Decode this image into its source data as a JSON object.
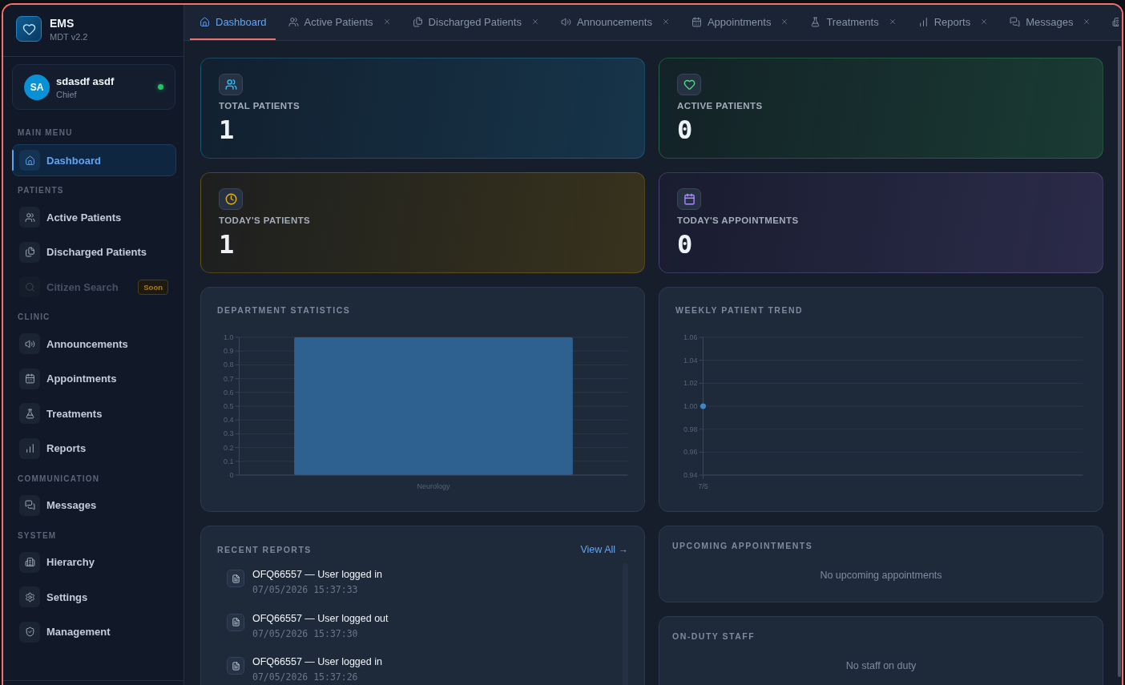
{
  "sidebar": {
    "brand": {
      "title": "EMS",
      "subtitle": "MDT v2.2"
    },
    "user": {
      "initials": "SA",
      "name": "sdasdf asdf",
      "role": "Chief",
      "online": true
    },
    "sections": [
      {
        "title": "MAIN MENU",
        "items": [
          {
            "label": "Dashboard",
            "selected": true,
            "disabled": false
          }
        ]
      },
      {
        "title": "PATIENTS",
        "items": [
          {
            "label": "Active Patients",
            "selected": false,
            "disabled": false
          },
          {
            "label": "Discharged Patients",
            "selected": false,
            "disabled": false
          },
          {
            "label": "Citizen Search",
            "selected": false,
            "disabled": true,
            "badge": "Soon"
          }
        ]
      },
      {
        "title": "CLINIC",
        "items": [
          {
            "label": "Announcements",
            "selected": false,
            "disabled": false
          },
          {
            "label": "Appointments",
            "selected": false,
            "disabled": false
          },
          {
            "label": "Treatments",
            "selected": false,
            "disabled": false
          },
          {
            "label": "Reports",
            "selected": false,
            "disabled": false
          }
        ]
      },
      {
        "title": "COMMUNICATION",
        "items": [
          {
            "label": "Messages",
            "selected": false,
            "disabled": false
          }
        ]
      },
      {
        "title": "SYSTEM",
        "items": [
          {
            "label": "Hierarchy",
            "selected": false,
            "disabled": false
          },
          {
            "label": "Settings",
            "selected": false,
            "disabled": false
          },
          {
            "label": "Management",
            "selected": false,
            "disabled": false
          }
        ]
      }
    ]
  },
  "tabs": [
    {
      "label": "Dashboard",
      "selected": true,
      "closable": false
    },
    {
      "label": "Active Patients",
      "selected": false,
      "closable": true
    },
    {
      "label": "Discharged Patients",
      "selected": false,
      "closable": true
    },
    {
      "label": "Announcements",
      "selected": false,
      "closable": true
    },
    {
      "label": "Appointments",
      "selected": false,
      "closable": true
    },
    {
      "label": "Treatments",
      "selected": false,
      "closable": true
    },
    {
      "label": "Reports",
      "selected": false,
      "closable": true
    },
    {
      "label": "Messages",
      "selected": false,
      "closable": true
    }
  ],
  "stats": [
    {
      "label": "TOTAL PATIENTS",
      "value": "1",
      "color": "#38bdf8"
    },
    {
      "label": "ACTIVE PATIENTS",
      "value": "0",
      "color": "#4ade80"
    },
    {
      "label": "TODAY'S PATIENTS",
      "value": "1",
      "color": "#eab308"
    },
    {
      "label": "TODAY'S APPOINTMENTS",
      "value": "0",
      "color": "#a78bfa"
    }
  ],
  "department_statistics": {
    "chart_data": {
      "type": "bar",
      "title": "DEPARTMENT STATISTICS",
      "categories": [
        "Neurology"
      ],
      "values": [
        1
      ],
      "ylim": [
        0,
        1
      ],
      "grid": true,
      "yticks": [
        {
          "value": 0,
          "label": "0"
        },
        {
          "value": 0.1,
          "label": "0.1"
        },
        {
          "value": 0.2,
          "label": "0.2"
        },
        {
          "value": 0.3,
          "label": "0.3"
        },
        {
          "value": 0.4,
          "label": "0.4"
        },
        {
          "value": 0.5,
          "label": "0.5"
        },
        {
          "value": 0.6,
          "label": "0.6"
        },
        {
          "value": 0.7,
          "label": "0.7"
        },
        {
          "value": 0.8,
          "label": "0.8"
        },
        {
          "value": 0.9,
          "label": "0.9"
        },
        {
          "value": 1,
          "label": "1.0"
        }
      ]
    }
  },
  "weekly_patient_trend": {
    "chart_data": {
      "type": "line",
      "title": "WEEKLY PATIENT TREND",
      "x": [
        "7/5"
      ],
      "series": [
        {
          "color": "#3b88c9",
          "marker": true,
          "values": [
            1
          ]
        }
      ],
      "ylim": [
        0.94,
        1.06
      ],
      "grid": true,
      "yticks": [
        {
          "value": 0.94,
          "label": "0.94"
        },
        {
          "value": 0.96,
          "label": "0.96"
        },
        {
          "value": 0.98,
          "label": "0.98"
        },
        {
          "value": 1,
          "label": "1.00"
        },
        {
          "value": 1.02,
          "label": "1.02"
        },
        {
          "value": 1.04,
          "label": "1.04"
        },
        {
          "value": 1.06,
          "label": "1.06"
        }
      ]
    }
  },
  "recent_reports": {
    "title": "RECENT REPORTS",
    "link": "View All →",
    "items": [
      {
        "title": "OFQ66557 — User logged in",
        "time": "07/05/2026 15:37:33"
      },
      {
        "title": "OFQ66557 — User logged out",
        "time": "07/05/2026 15:37:30"
      },
      {
        "title": "OFQ66557 — User logged in",
        "time": "07/05/2026 15:37:26"
      }
    ]
  },
  "upcoming_appointments": {
    "title": "UPCOMING APPOINTMENTS",
    "empty_text": "No upcoming appointments"
  },
  "on_duty_staff": {
    "title": "ON-DUTY STAFF",
    "empty_text": "No staff on duty"
  }
}
